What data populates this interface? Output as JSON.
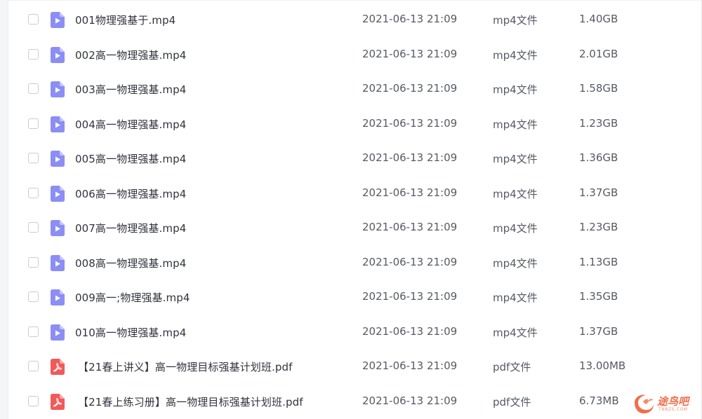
{
  "files": [
    {
      "name": "001物理强基于.mp4",
      "date": "2021-06-13 21:09",
      "type": "mp4文件",
      "size": "1.40GB",
      "icon": "video-file-icon"
    },
    {
      "name": "002高一物理强基.mp4",
      "date": "2021-06-13 21:09",
      "type": "mp4文件",
      "size": "2.01GB",
      "icon": "video-file-icon"
    },
    {
      "name": "003高一物理强基.mp4",
      "date": "2021-06-13 21:09",
      "type": "mp4文件",
      "size": "1.58GB",
      "icon": "video-file-icon"
    },
    {
      "name": "004高一物理强基.mp4",
      "date": "2021-06-13 21:09",
      "type": "mp4文件",
      "size": "1.23GB",
      "icon": "video-file-icon"
    },
    {
      "name": "005高一物理强基.mp4",
      "date": "2021-06-13 21:09",
      "type": "mp4文件",
      "size": "1.36GB",
      "icon": "video-file-icon"
    },
    {
      "name": "006高一物理强基.mp4",
      "date": "2021-06-13 21:09",
      "type": "mp4文件",
      "size": "1.37GB",
      "icon": "video-file-icon"
    },
    {
      "name": "007高一物理强基.mp4",
      "date": "2021-06-13 21:09",
      "type": "mp4文件",
      "size": "1.23GB",
      "icon": "video-file-icon"
    },
    {
      "name": "008高一物理强基.mp4",
      "date": "2021-06-13 21:09",
      "type": "mp4文件",
      "size": "1.13GB",
      "icon": "video-file-icon"
    },
    {
      "name": "009高一;物理强基.mp4",
      "date": "2021-06-13 21:09",
      "type": "mp4文件",
      "size": "1.35GB",
      "icon": "video-file-icon"
    },
    {
      "name": "010高一物理强基.mp4",
      "date": "2021-06-13 21:09",
      "type": "mp4文件",
      "size": "1.37GB",
      "icon": "video-file-icon"
    },
    {
      "name": "【21春上讲义】高一物理目标强基计划班.pdf",
      "date": "2021-06-13 21:09",
      "type": "pdf文件",
      "size": "13.00MB",
      "icon": "pdf-file-icon"
    },
    {
      "name": "【21春上练习册】高一物理目标强基计划班.pdf",
      "date": "2021-06-13 21:09",
      "type": "pdf文件",
      "size": "6.73MB",
      "icon": "pdf-file-icon"
    }
  ],
  "watermark": {
    "text": "途鸟吧",
    "subtext": "TNBZS.COM",
    "icon": "bird-logo-icon"
  },
  "colors": {
    "video_icon": "#8b8ef5",
    "pdf_icon": "#f25a5a",
    "watermark": "#f36d4a"
  }
}
